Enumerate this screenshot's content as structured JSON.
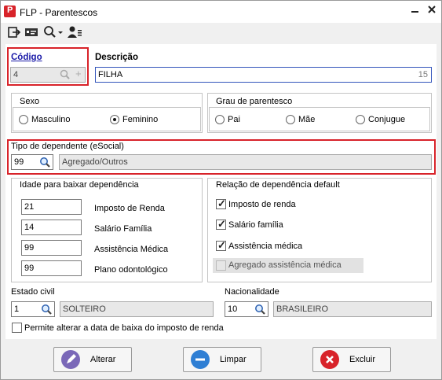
{
  "window": {
    "title": "FLP - Parentescos"
  },
  "codigo": {
    "label": "Código",
    "value": "4"
  },
  "descricao": {
    "label": "Descrição",
    "value": "FILHA",
    "counter": "15"
  },
  "sexo": {
    "label": "Sexo",
    "options": [
      "Masculino",
      "Feminino"
    ],
    "selected": "Feminino"
  },
  "grau": {
    "label": "Grau de parentesco",
    "options": [
      "Pai",
      "Mãe",
      "Conjugue"
    ]
  },
  "tipo_dependente": {
    "label": "Tipo de dependente (eSocial)",
    "code": "99",
    "description": "Agregado/Outros"
  },
  "idade": {
    "label": "Idade para baixar dependência",
    "items": [
      {
        "value": "21",
        "label": "Imposto de Renda"
      },
      {
        "value": "14",
        "label": "Salário Família"
      },
      {
        "value": "99",
        "label": "Assistência Médica"
      },
      {
        "value": "99",
        "label": "Plano odontológico"
      }
    ]
  },
  "relacao": {
    "label": "Relação de dependência default",
    "items": [
      {
        "label": "Imposto de renda",
        "checked": true
      },
      {
        "label": "Salário família",
        "checked": true
      },
      {
        "label": "Assistência médica",
        "checked": true
      },
      {
        "label": "Agregado assistência médica",
        "checked": false,
        "disabled": true
      }
    ]
  },
  "estado_civil": {
    "label": "Estado civil",
    "code": "1",
    "description": "SOLTEIRO"
  },
  "nacionalidade": {
    "label": "Nacionalidade",
    "code": "10",
    "description": "BRASILEIRO"
  },
  "permite": {
    "label": "Permite alterar a data de baixa do imposto de renda",
    "checked": false
  },
  "buttons": {
    "alterar": "Alterar",
    "limpar": "Limpar",
    "excluir": "Excluir"
  },
  "colors": {
    "accent_red": "#d8232a",
    "label_blue": "#1a1aa8"
  }
}
